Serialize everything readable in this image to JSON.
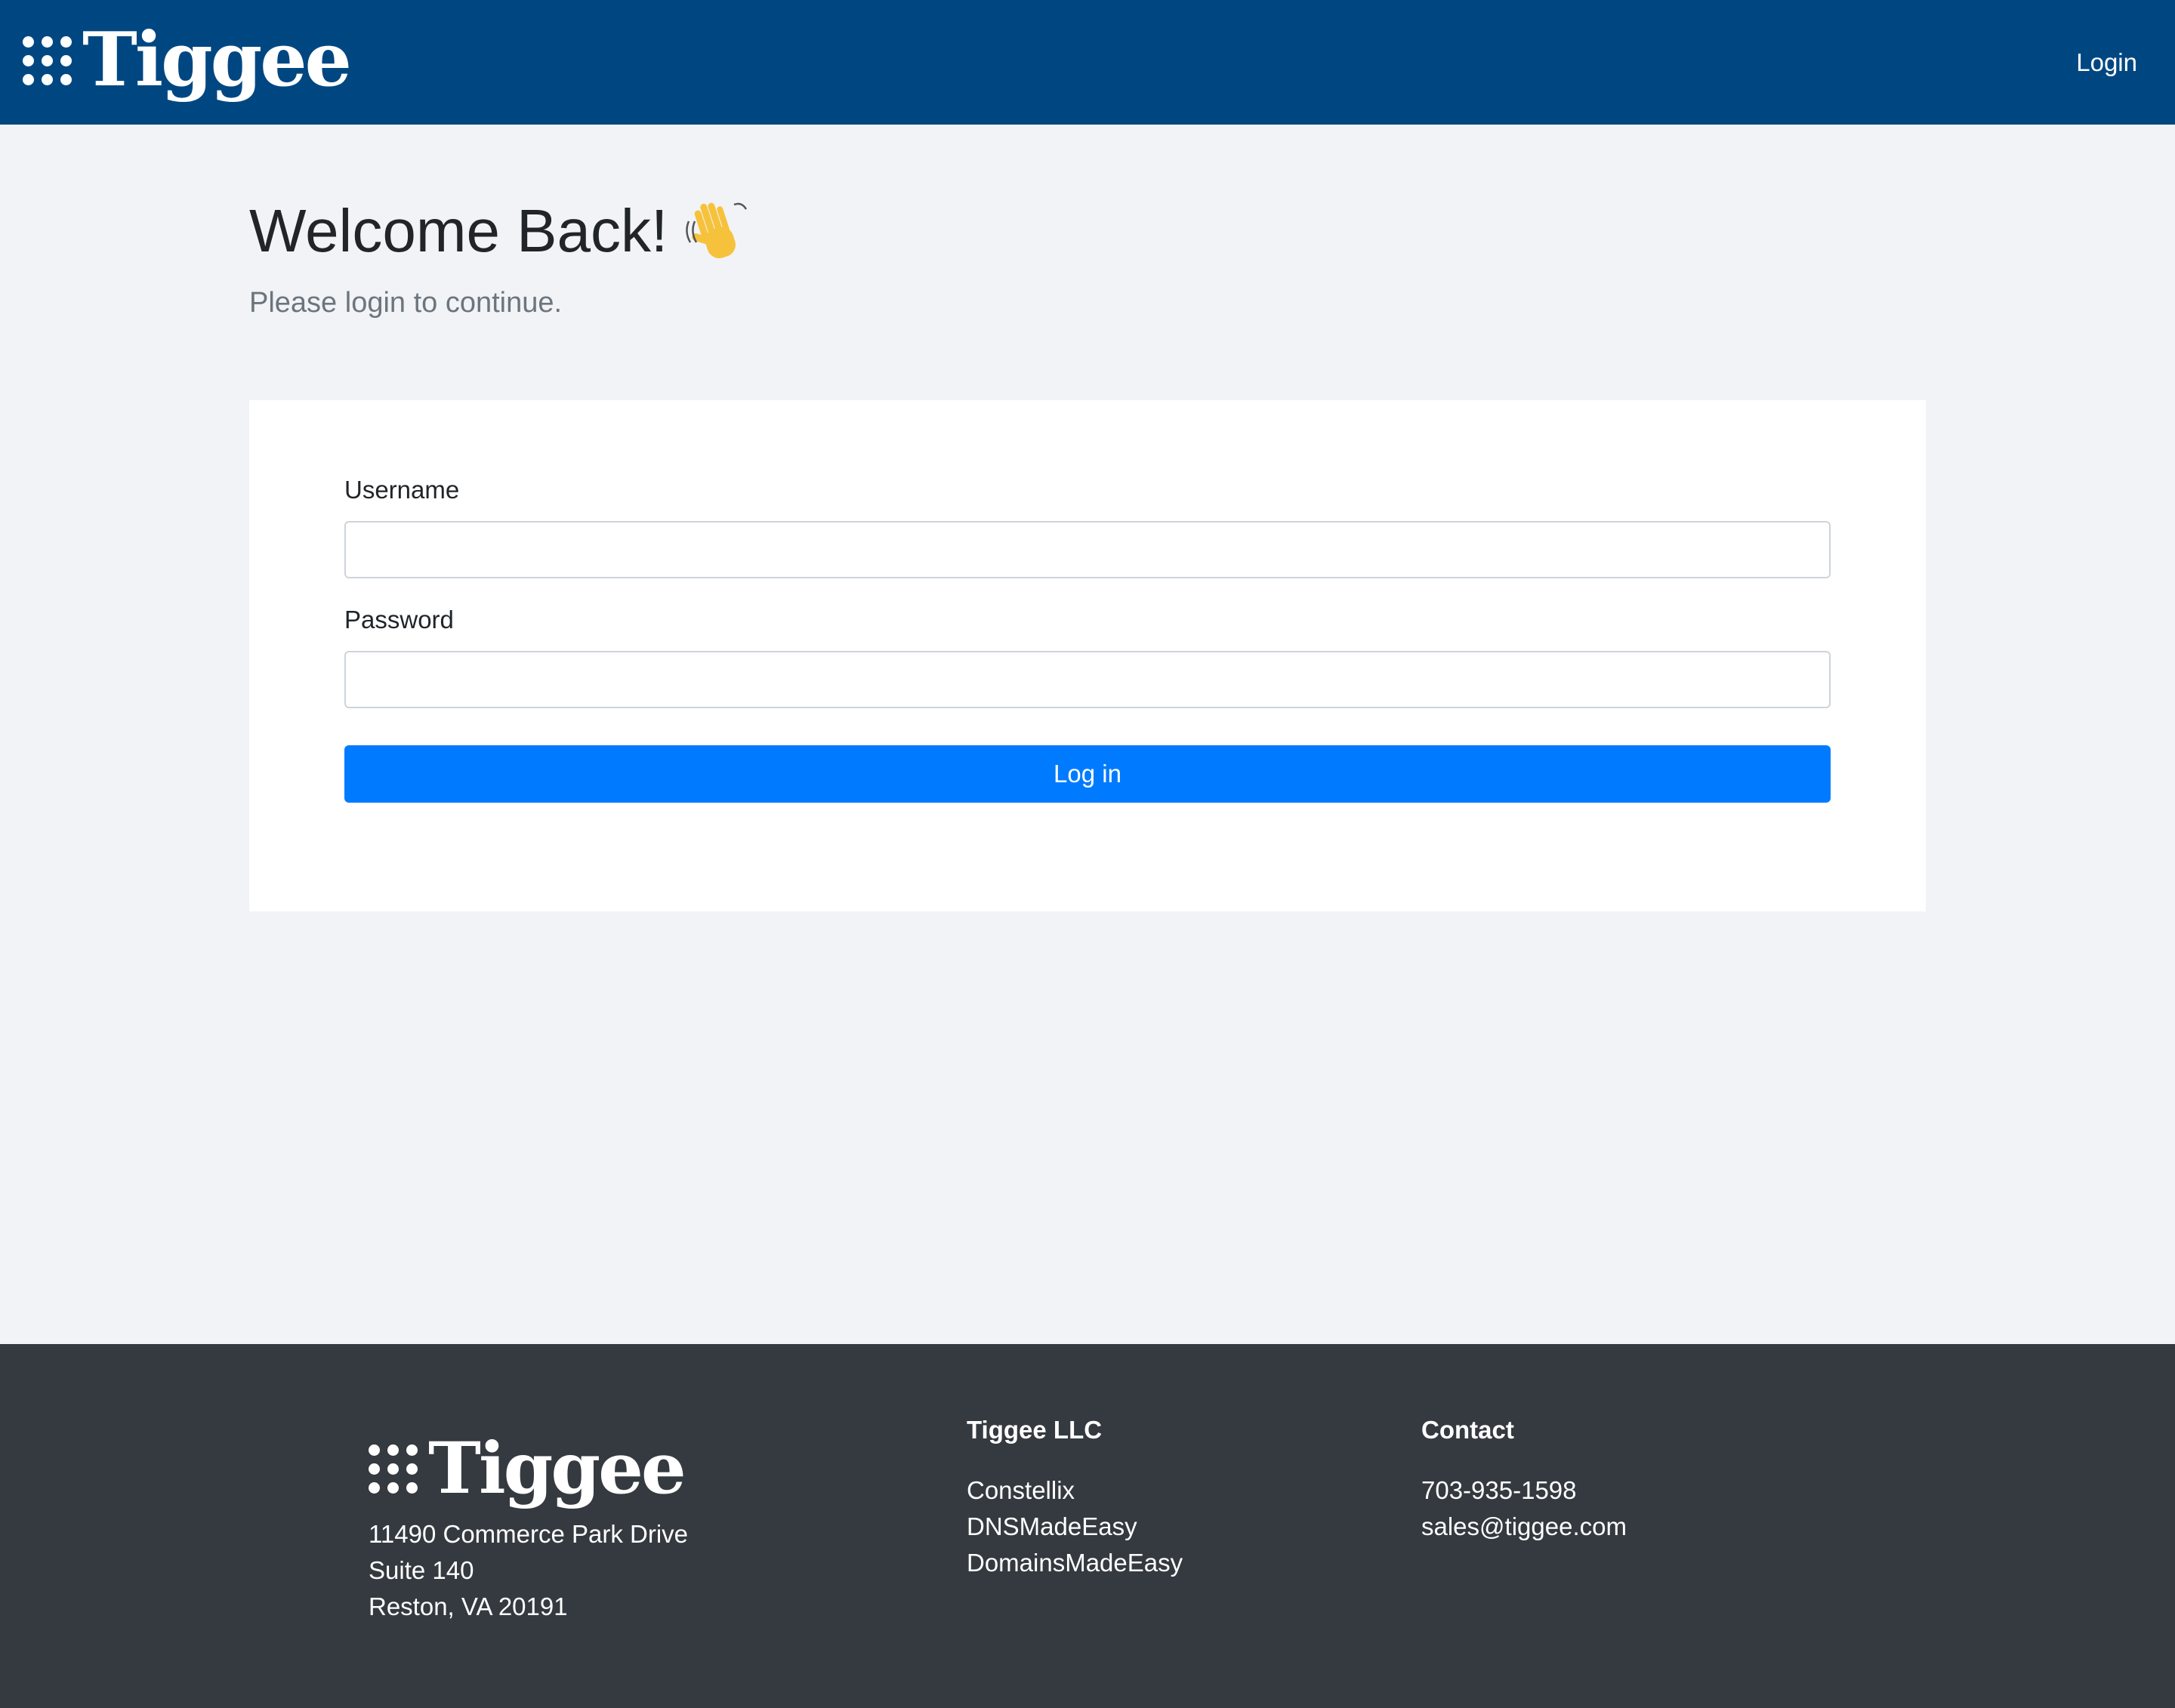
{
  "header": {
    "brand": "Tiggee",
    "nav_login": "Login"
  },
  "main": {
    "title": "Welcome Back!",
    "wave_emoji": "👋",
    "subtitle": "Please login to continue."
  },
  "form": {
    "username_label": "Username",
    "username_value": "",
    "password_label": "Password",
    "password_value": "",
    "submit_label": "Log in"
  },
  "footer": {
    "brand": "Tiggee",
    "address": [
      "11490 Commerce Park Drive",
      "Suite 140",
      "Reston, VA 20191"
    ],
    "company_heading": "Tiggee LLC",
    "company_links": [
      "Constellix",
      "DNSMadeEasy",
      "DomainsMadeEasy"
    ],
    "contact_heading": "Contact",
    "contact_phone": "703-935-1598",
    "contact_email": "sales@tiggee.com"
  },
  "colors": {
    "header_bg": "#004782",
    "page_bg": "#f1f3f6",
    "primary_button": "#007bff",
    "footer_bg": "#343a40"
  }
}
